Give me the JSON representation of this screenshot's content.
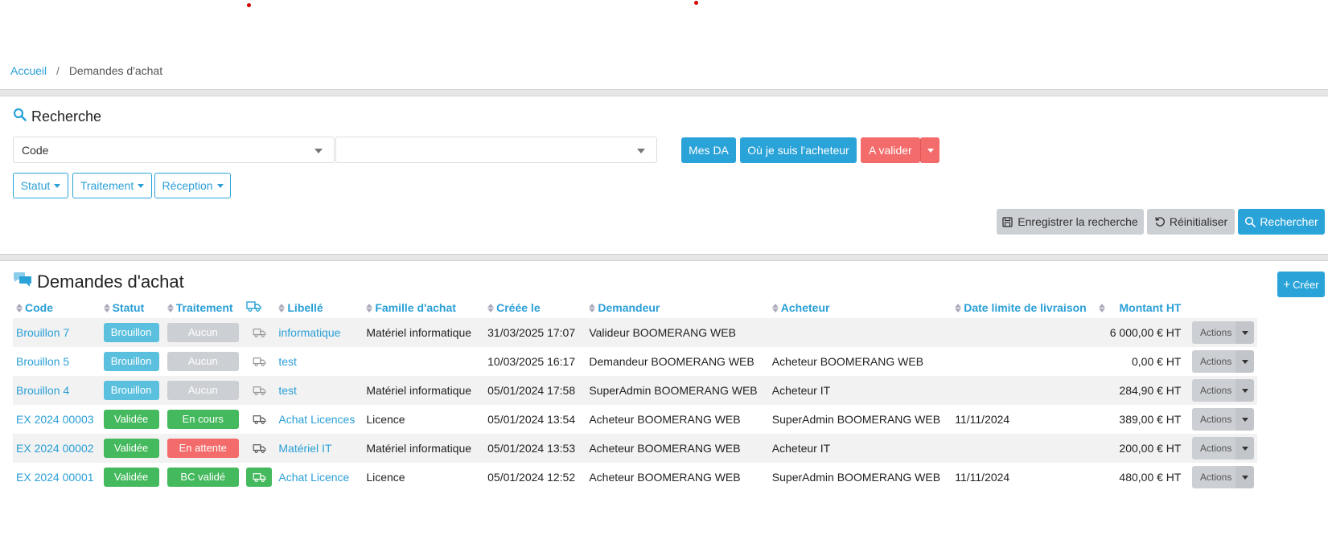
{
  "breadcrumb": {
    "home": "Accueil",
    "current": "Demandes d'achat"
  },
  "search": {
    "title": "Recherche",
    "field_select": "Code",
    "value_select": "",
    "quick_filters": {
      "mine": "Mes DA",
      "buyer": "Où je suis l'acheteur",
      "to_validate": "A valider"
    },
    "dropdowns": {
      "status": "Statut",
      "processing": "Traitement",
      "reception": "Réception"
    },
    "save": "Enregistrer la recherche",
    "reset": "Réinitialiser",
    "search": "Rechercher"
  },
  "list": {
    "title": "Demandes d'achat",
    "create": "Créer",
    "columns": {
      "code": "Code",
      "status": "Statut",
      "processing": "Traitement",
      "label": "Libellé",
      "family": "Famille d'achat",
      "created": "Créée le",
      "requester": "Demandeur",
      "buyer": "Acheteur",
      "deadline": "Date limite de livraison",
      "amount": "Montant HT"
    },
    "actions_label": "Actions",
    "rows": [
      {
        "code": "Brouillon 7",
        "status": "Brouillon",
        "processing": "Aucun",
        "label": "informatique",
        "family": "Matériel informatique",
        "created": "31/03/2025 17:07",
        "requester": "Valideur BOOMERANG WEB",
        "buyer": "",
        "deadline": "",
        "amount": "6 000,00 € HT"
      },
      {
        "code": "Brouillon 5",
        "status": "Brouillon",
        "processing": "Aucun",
        "label": "test",
        "family": "",
        "created": "10/03/2025 16:17",
        "requester": "Demandeur BOOMERANG WEB",
        "buyer": "Acheteur BOOMERANG WEB",
        "deadline": "",
        "amount": "0,00 € HT"
      },
      {
        "code": "Brouillon 4",
        "status": "Brouillon",
        "processing": "Aucun",
        "label": "test",
        "family": "Matériel informatique",
        "created": "05/01/2024 17:58",
        "requester": "SuperAdmin BOOMERANG WEB",
        "buyer": "Acheteur IT",
        "deadline": "",
        "amount": "284,90 € HT"
      },
      {
        "code": "EX 2024 00003",
        "status": "Validée",
        "processing": "En cours",
        "label": "Achat Licences",
        "family": "Licence",
        "created": "05/01/2024 13:54",
        "requester": "Acheteur BOOMERANG WEB",
        "buyer": "SuperAdmin BOOMERANG WEB",
        "deadline": "11/11/2024",
        "amount": "389,00 € HT"
      },
      {
        "code": "EX 2024 00002",
        "status": "Validée",
        "processing": "En attente",
        "label": "Matériel IT",
        "family": "Matériel informatique",
        "created": "05/01/2024 13:53",
        "requester": "Acheteur BOOMERANG WEB",
        "buyer": "Acheteur IT",
        "deadline": "",
        "amount": "200,00 € HT"
      },
      {
        "code": "EX 2024 00001",
        "status": "Validée",
        "processing": "BC validé",
        "label": "Achat Licence",
        "family": "Licence",
        "created": "05/01/2024 12:52",
        "requester": "Acheteur BOOMERANG WEB",
        "buyer": "SuperAdmin BOOMERANG WEB",
        "deadline": "11/11/2024",
        "amount": "480,00 € HT"
      }
    ]
  },
  "colors": {
    "accent": "#2aa3d8",
    "danger": "#f46b6b",
    "success": "#45b95d",
    "neutral": "#cccfd3",
    "draft": "#5bc0de"
  }
}
